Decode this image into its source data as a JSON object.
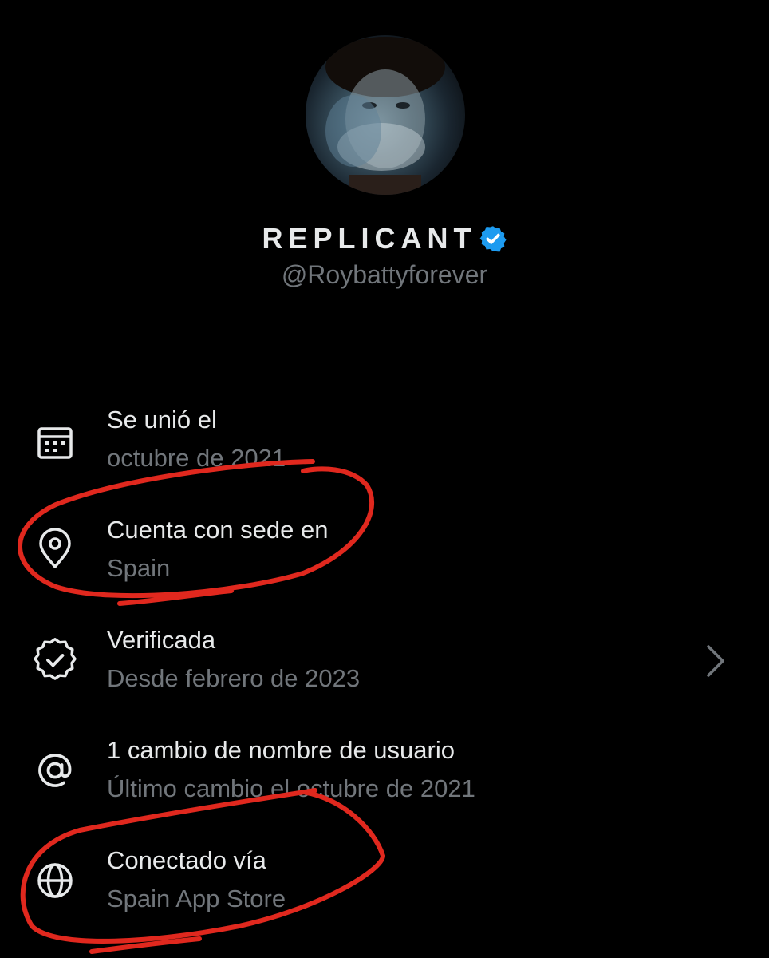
{
  "profile": {
    "display_name": "REPLICANT",
    "handle": "@Roybattyforever",
    "verified": true
  },
  "info": [
    {
      "icon": "calendar-icon",
      "title": "Se unió el",
      "subtitle": "octubre de 2021"
    },
    {
      "icon": "location-pin-icon",
      "title": "Cuenta con sede en",
      "subtitle": "Spain"
    },
    {
      "icon": "verified-check-icon",
      "title": "Verificada",
      "subtitle": "Desde febrero de 2023",
      "has_chevron": true
    },
    {
      "icon": "at-sign-icon",
      "title": "1 cambio de nombre de usuario",
      "subtitle": "Último cambio el octubre de 2021"
    },
    {
      "icon": "globe-icon",
      "title": "Conectado vía",
      "subtitle": "Spain App Store"
    }
  ],
  "colors": {
    "background": "#000000",
    "primary_text": "#e7e9ea",
    "secondary_text": "#71767b",
    "verified_blue": "#1d9bf0",
    "annotation_red": "#e0281e"
  }
}
